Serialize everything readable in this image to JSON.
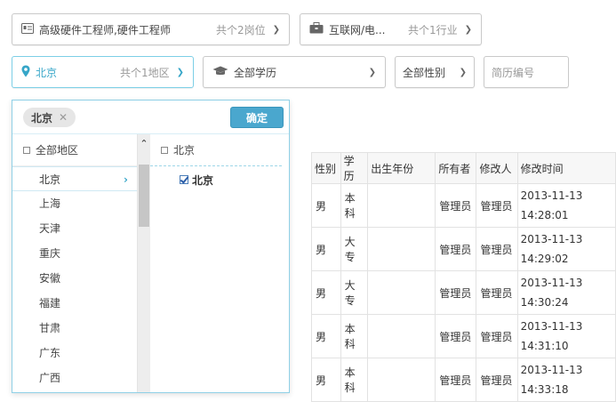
{
  "filters": {
    "position": {
      "label": "高级硬件工程师,硬件工程师",
      "count": "共个2岗位",
      "icon": "id-card-icon"
    },
    "industry": {
      "label": "互联网/电...",
      "count": "共个1行业",
      "icon": "briefcase-icon"
    },
    "region": {
      "label": "北京",
      "count": "共个1地区",
      "icon": "location-pin-icon"
    },
    "education": {
      "label": "全部学历",
      "icon": "graduation-cap-icon"
    },
    "gender": {
      "label": "全部性别"
    },
    "resume_no": {
      "placeholder": "简历编号"
    }
  },
  "region_panel": {
    "selected_tag": "北京",
    "confirm_label": "确定",
    "all_label": "全部地区",
    "provinces": [
      "北京",
      "上海",
      "天津",
      "重庆",
      "安徽",
      "福建",
      "甘肃",
      "广东",
      "广西"
    ],
    "current_province": "北京",
    "sub_header": "北京",
    "cities": [
      {
        "label": "北京",
        "checked": true
      }
    ]
  },
  "table": {
    "headers": [
      "性别",
      "学历",
      "出生年份",
      "所有者",
      "修改人",
      "修改时间"
    ],
    "rows": [
      [
        "男",
        "本科",
        "",
        "管理员",
        "管理员",
        "2013-11-13",
        "14:28:01"
      ],
      [
        "男",
        "大专",
        "",
        "管理员",
        "管理员",
        "2013-11-13",
        "14:29:02"
      ],
      [
        "男",
        "大专",
        "",
        "管理员",
        "管理员",
        "2013-11-13",
        "14:30:24"
      ],
      [
        "男",
        "本科",
        "",
        "管理员",
        "管理员",
        "2013-11-13",
        "14:31:10"
      ],
      [
        "男",
        "本科",
        "",
        "管理员",
        "管理员",
        "2013-11-13",
        "14:33:18"
      ]
    ]
  },
  "colors": {
    "accent": "#36a6c8",
    "button": "#4aa7ce"
  }
}
